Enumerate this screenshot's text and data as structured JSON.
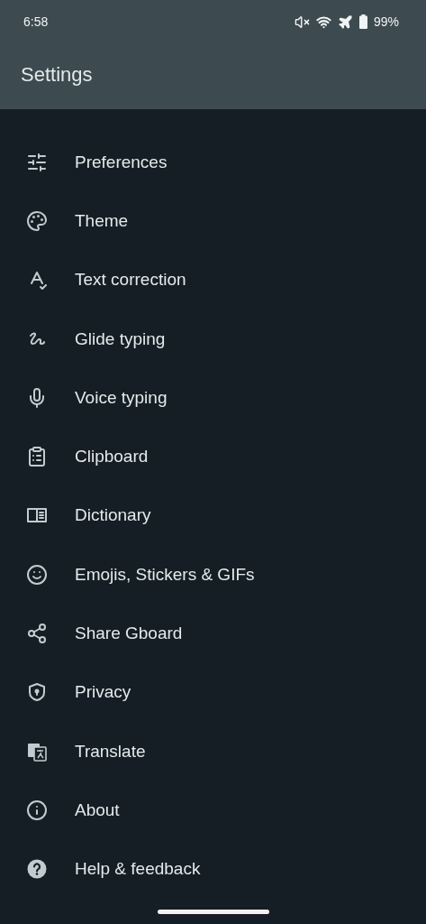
{
  "status_bar": {
    "time": "6:58",
    "battery": "99%"
  },
  "app_bar": {
    "title": "Settings"
  },
  "items": [
    {
      "kind": "sliders",
      "label": "Preferences"
    },
    {
      "kind": "palette",
      "label": "Theme"
    },
    {
      "kind": "spellcheck",
      "label": "Text correction"
    },
    {
      "kind": "squiggle",
      "label": "Glide typing"
    },
    {
      "kind": "mic",
      "label": "Voice typing"
    },
    {
      "kind": "clipboard",
      "label": "Clipboard"
    },
    {
      "kind": "book",
      "label": "Dictionary"
    },
    {
      "kind": "smile",
      "label": "Emojis, Stickers & GIFs"
    },
    {
      "kind": "share",
      "label": "Share Gboard"
    },
    {
      "kind": "shield",
      "label": "Privacy"
    },
    {
      "kind": "translate",
      "label": "Translate"
    },
    {
      "kind": "info",
      "label": "About"
    },
    {
      "kind": "help",
      "label": "Help & feedback"
    }
  ]
}
